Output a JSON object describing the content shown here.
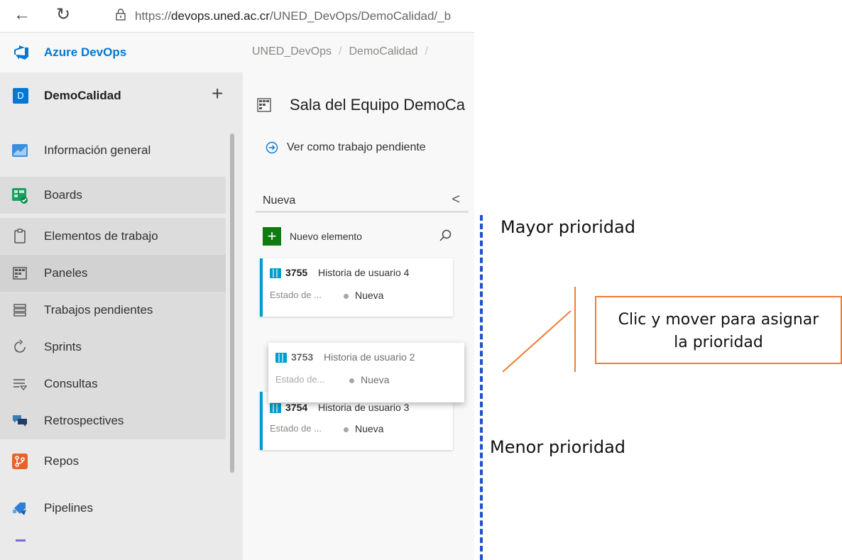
{
  "browser": {
    "back_icon": "back-arrow-icon",
    "refresh_icon": "refresh-icon",
    "url_prefix": "https://",
    "url_domain": "devops.uned.ac.cr",
    "url_path": "/UNED_DevOps/DemoCalidad/_b"
  },
  "header": {
    "brand": "Azure DevOps",
    "breadcrumb": [
      "UNED_DevOps",
      "DemoCalidad"
    ],
    "separator": "/"
  },
  "sidebar": {
    "project_initial": "D",
    "project_name": "DemoCalidad",
    "add_symbol": "+",
    "items": [
      {
        "label": "Información general",
        "icon": "overview-icon"
      },
      {
        "label": "Boards",
        "icon": "boards-icon"
      },
      {
        "label": "Elementos de trabajo",
        "icon": "work-items-icon"
      },
      {
        "label": "Paneles",
        "icon": "panels-icon"
      },
      {
        "label": "Trabajos pendientes",
        "icon": "backlogs-icon"
      },
      {
        "label": "Sprints",
        "icon": "sprints-icon"
      },
      {
        "label": "Consultas",
        "icon": "queries-icon"
      },
      {
        "label": "Retrospectives",
        "icon": "retrospectives-icon"
      },
      {
        "label": "Repos",
        "icon": "repos-icon"
      },
      {
        "label": "Pipelines",
        "icon": "pipelines-icon"
      }
    ]
  },
  "main": {
    "team_title": "Sala del Equipo DemoCa",
    "view_link": "Ver como trabajo pendiente",
    "column_title": "Nueva",
    "collapse_symbol": "<",
    "new_item_plus": "+",
    "new_item_label": "Nuevo elemento",
    "cards": [
      {
        "id": "3755",
        "title": "Historia de usuario 4",
        "state_label": "Estado de ...",
        "state": "Nueva"
      },
      {
        "id": "3753",
        "title": "Historia de usuario 2",
        "state_label": "Estado de...",
        "state": "Nueva"
      },
      {
        "id": "3754",
        "title": "Historia de usuario 3",
        "state_label": "Estado de ...",
        "state": "Nueva"
      }
    ]
  },
  "annotations": {
    "top": "Mayor prioridad",
    "bottom": "Menor prioridad",
    "callout_line1": "Clic y mover para asignar",
    "callout_line2": "la prioridad"
  },
  "colors": {
    "accent": "#0078d4",
    "story_bar": "#009ccc",
    "new_green": "#107c10",
    "dash_blue": "#1f4fd3",
    "callout_orange": "#ed7d31"
  }
}
